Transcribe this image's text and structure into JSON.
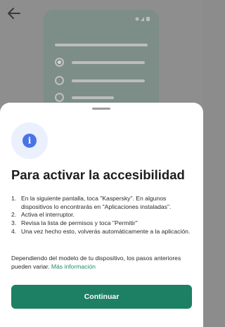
{
  "background": {
    "back_icon": "arrow-left-icon",
    "illustration": "phone-permission-list-illustration"
  },
  "sheet": {
    "icon": "info-icon",
    "icon_glyph": "i",
    "title": "Para activar la accesibilidad",
    "steps": [
      {
        "num": "1.",
        "text": "En la siguiente pantalla, toca \"Kaspersky\". En algunos dispositivos lo encontrarás en \"Aplicaciones instaladas\"."
      },
      {
        "num": "2.",
        "text": "Activa el interruptor."
      },
      {
        "num": "3.",
        "text": "Revisa la lista de permisos y toca \"Permitir\""
      },
      {
        "num": "4.",
        "text": "Una vez hecho esto, volverás automáticamente a la aplicación."
      }
    ],
    "note": "Dependiendo del modelo de tu dispositivo, los pasos anteriores pueden variar.",
    "more_info_link": "Más información",
    "continue_label": "Continuar"
  },
  "colors": {
    "accent": "#1d7f64",
    "link": "#1f8a6b",
    "info": "#4a73e8"
  }
}
